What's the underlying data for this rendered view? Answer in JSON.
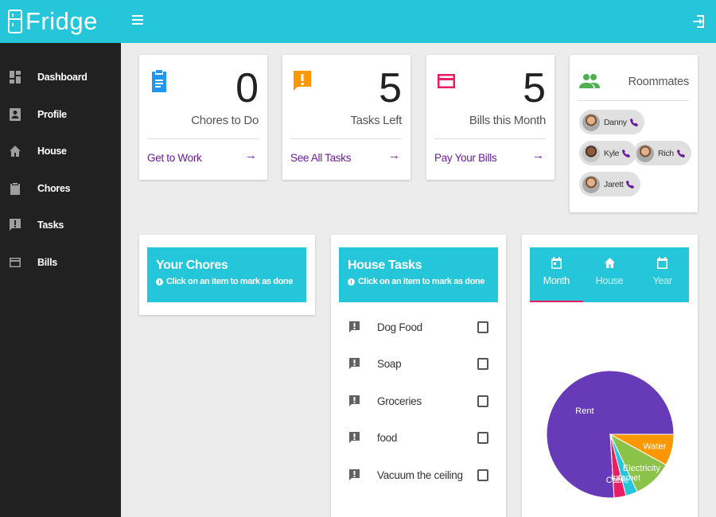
{
  "app": {
    "name": "Fridge"
  },
  "sidebar": {
    "items": [
      {
        "label": "Dashboard",
        "icon": "dashboard-icon"
      },
      {
        "label": "Profile",
        "icon": "profile-icon"
      },
      {
        "label": "House",
        "icon": "home-icon"
      },
      {
        "label": "Chores",
        "icon": "clipboard-icon"
      },
      {
        "label": "Tasks",
        "icon": "task-icon"
      },
      {
        "label": "Bills",
        "icon": "card-icon"
      }
    ]
  },
  "stats": [
    {
      "value": "0",
      "caption": "Chores to Do",
      "link": "Get to Work",
      "icon": "clipboard-icon",
      "color": "#2196f3"
    },
    {
      "value": "5",
      "caption": "Tasks Left",
      "link": "See All Tasks",
      "icon": "task-icon",
      "color": "#ff9800"
    },
    {
      "value": "5",
      "caption": "Bills this Month",
      "link": "Pay Your Bills",
      "icon": "card-icon",
      "color": "#e91e63"
    }
  ],
  "roommates": {
    "title": "Roommates",
    "people": [
      "Danny",
      "Kyle",
      "Rich",
      "Jarett"
    ]
  },
  "your_chores": {
    "title": "Your Chores",
    "hint": "Click on an item to mark as done"
  },
  "house_tasks": {
    "title": "House Tasks",
    "hint": "Click on an item to mark as done",
    "items": [
      "Dog Food",
      "Soap",
      "Groceries",
      "food",
      "Vacuum the ceiling"
    ]
  },
  "bills_chart": {
    "tabs": [
      "Month",
      "House",
      "Year"
    ],
    "active_tab": "Month"
  },
  "chart_data": {
    "type": "pie",
    "labels": [
      "Rent",
      "Water",
      "Electricity",
      "Internet",
      "Cable"
    ],
    "values": [
      76,
      8,
      10,
      3,
      3
    ],
    "colors": [
      "#673ab7",
      "#ff9800",
      "#8bc34a",
      "#26c6da",
      "#e91e63"
    ]
  },
  "colors": {
    "accent": "#26c6da",
    "sidebar": "#212121",
    "link": "#6a1b9a"
  }
}
